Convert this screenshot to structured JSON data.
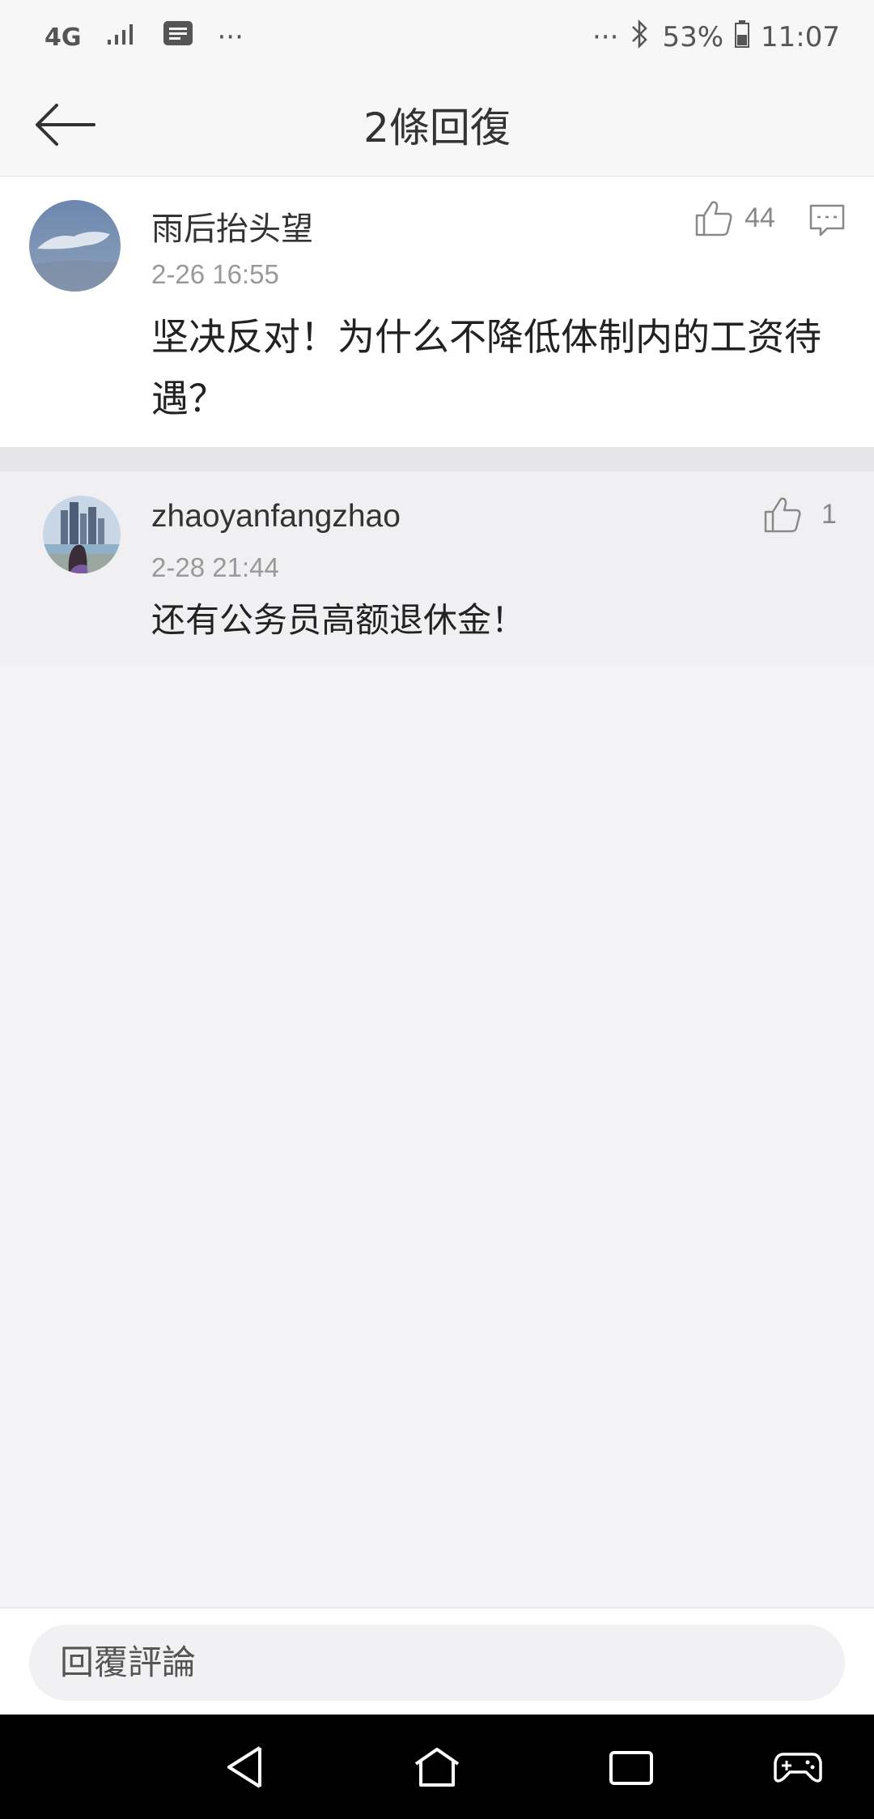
{
  "status_bar": {
    "network": "4G",
    "icons": [
      "network-4g-icon",
      "signal-icon",
      "message-icon",
      "more-dots-icon",
      "more-dots-icon",
      "bluetooth-icon",
      "battery-icon"
    ],
    "battery": "53%",
    "time": "11:07"
  },
  "header": {
    "title": "2條回復"
  },
  "main_comment": {
    "username": "雨后抬头望",
    "timestamp": "2-26 16:55",
    "text": "坚决反对！为什么不降低体制内的工资待遇？",
    "likes": "44"
  },
  "replies": [
    {
      "username": "zhaoyanfangzhao",
      "timestamp": "2-28 21:44",
      "text": "还有公务员高额退休金！",
      "likes": "1"
    }
  ],
  "reply_input": {
    "placeholder": "回覆評論"
  },
  "colors": {
    "header_bg": "#f7f7f7",
    "reply_bg": "#f0f0f3",
    "page_bg": "#f3f3f7",
    "text_secondary": "#999999",
    "icon_gray": "#888888"
  }
}
